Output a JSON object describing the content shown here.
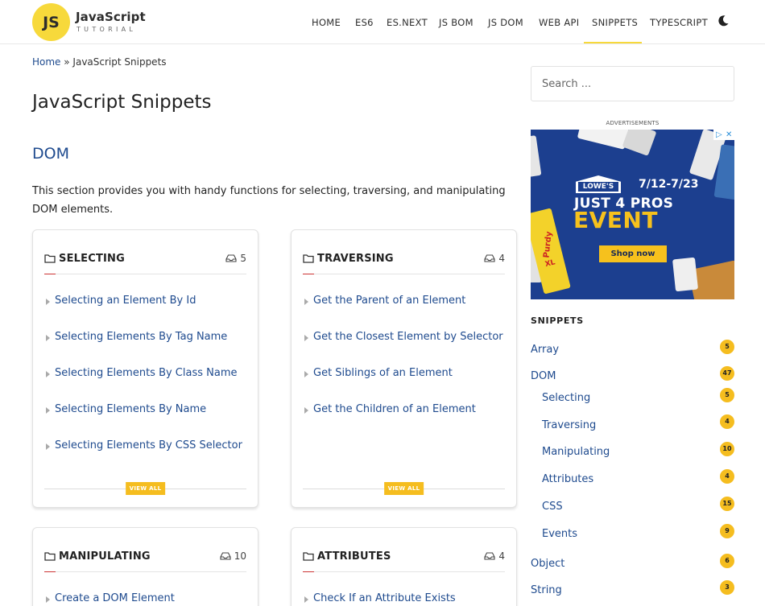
{
  "header": {
    "logo_mark": "JS",
    "logo_title": "JavaScript",
    "logo_subtitle": "TUTORIAL",
    "nav": [
      "HOME",
      "ES6",
      "ES.NEXT",
      "JS BOM",
      "JS DOM",
      "WEB API",
      "SNIPPETS",
      "TYPESCRIPT"
    ],
    "active_nav": "SNIPPETS",
    "theme_icon": "moon-icon",
    "accent_color": "#f7d93b"
  },
  "breadcrumb": {
    "home": "Home",
    "separator": " » ",
    "current": "JavaScript Snippets"
  },
  "page_title": "JavaScript Snippets",
  "section": {
    "title": "DOM",
    "description": "This section provides you with handy functions for selecting, traversing, and manipulating DOM elements."
  },
  "cards": [
    {
      "title": "SELECTING",
      "count": "5",
      "items": [
        "Selecting an Element By Id",
        "Selecting Elements By Tag Name",
        "Selecting Elements By Class Name",
        "Selecting Elements By Name",
        "Selecting Elements By CSS Selector"
      ],
      "view_all": "VIEW ALL"
    },
    {
      "title": "TRAVERSING",
      "count": "4",
      "items": [
        "Get the Parent of an Element",
        "Get the Closest Element by Selector",
        "Get Siblings of an Element",
        "Get the Children of an Element"
      ],
      "view_all": "VIEW ALL"
    },
    {
      "title": "MANIPULATING",
      "count": "10",
      "items": [
        "Create a DOM Element"
      ]
    },
    {
      "title": "ATTRIBUTES",
      "count": "4",
      "items": [
        "Check If an Attribute Exists"
      ]
    }
  ],
  "sidebar": {
    "search_placeholder": "Search ...",
    "ad_label": "ADVERTISEMENTS",
    "ad": {
      "brand": "LOWE'S",
      "dates": "7/12-7/23",
      "line1": "JUST 4 PROS",
      "line2": "EVENT",
      "cta": "Shop now",
      "can_brand": "Purdy",
      "can_sub": "XL"
    },
    "snippets_heading": "SNIPPETS",
    "snippets": [
      {
        "label": "Array",
        "count": "5"
      },
      {
        "label": "DOM",
        "count": "47"
      },
      {
        "label": "Selecting",
        "count": "5"
      },
      {
        "label": "Traversing",
        "count": "4"
      },
      {
        "label": "Manipulating",
        "count": "10"
      },
      {
        "label": "Attributes",
        "count": "4"
      },
      {
        "label": "CSS",
        "count": "15"
      },
      {
        "label": "Events",
        "count": "9"
      },
      {
        "label": "Object",
        "count": "6"
      },
      {
        "label": "String",
        "count": "3"
      }
    ],
    "badge_color": "#f5bd1f",
    "link_color": "#1e4a8e"
  }
}
